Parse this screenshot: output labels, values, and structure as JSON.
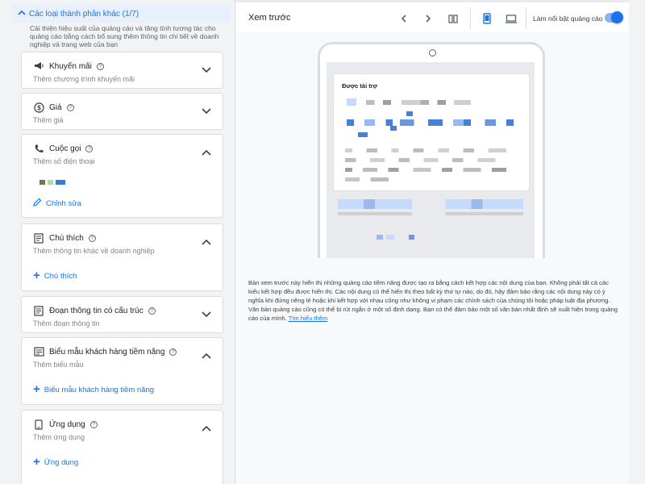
{
  "left_panel": {
    "section_title": "Các loại thành phần khác (1/7)",
    "section_description": "Cải thiện hiệu suất của quảng cáo và tăng tính tương tác cho quảng cáo bằng cách bổ sung thêm thông tin chi tiết về doanh nghiệp và trang web của bạn",
    "cards": [
      {
        "title": "Khuyến mãi",
        "subtitle": "Thêm chương trình khuyến mãi",
        "icon": "megaphone-icon",
        "expanded": false
      },
      {
        "title": "Giá",
        "subtitle": "Thêm giá",
        "icon": "dollar-icon",
        "expanded": false
      },
      {
        "title": "Cuộc gọi",
        "subtitle": "Thêm số điện thoại",
        "icon": "phone-icon",
        "expanded": true,
        "action": "Chỉnh sửa",
        "action_icon": "pencil-icon"
      },
      {
        "title": "Chú thích",
        "subtitle": "Thêm thông tin khác về doanh nghiệp",
        "icon": "document-icon",
        "expanded": true,
        "action": "Chú thích",
        "action_icon": "plus-icon"
      },
      {
        "title": "Đoạn thông tin có cấu trúc",
        "subtitle": "Thêm đoạn thông tin",
        "icon": "document-icon",
        "expanded": false
      },
      {
        "title": "Biểu mẫu khách hàng tiềm năng",
        "subtitle": "Thêm biểu mẫu",
        "icon": "form-icon",
        "expanded": true,
        "action": "Biểu mẫu khách hàng tiềm năng",
        "action_icon": "plus-icon"
      },
      {
        "title": "Ứng dụng",
        "subtitle": "Thêm ứng dụng",
        "icon": "mobile-icon",
        "expanded": true,
        "action": "Ứng dụng",
        "action_icon": "plus-icon"
      }
    ]
  },
  "preview": {
    "title": "Xem trước",
    "highlight_label": "Làm nổi bật quảng cáo",
    "highlight_enabled": true,
    "sponsored_label": "Được tài trợ",
    "disclaimer": "Bản xem trước này hiển thị những quảng cáo tiềm năng được tạo ra bằng cách kết hợp các nội dung của bạn. Không phải tất cả các kiểu kết hợp đều được hiển thị. Các nội dung có thể hiển thị theo bất kỳ thứ tự nào, do đó, hãy đảm bảo rằng các nội dung này có ý nghĩa khi đứng riêng lẻ hoặc khi kết hợp với nhau cũng như không vi phạm các chính sách của chúng tôi hoặc pháp luật địa phương. Văn bản quảng cáo cũng có thể bị rút ngắn ở một số định dạng. Bạn có thể đảm bảo một số văn bản nhất định sẽ xuất hiện trong quảng cáo của mình.",
    "learn_more": "Tìm hiểu thêm"
  },
  "colors": {
    "accent": "#1a73e8",
    "panel_bg": "#f1f3f4"
  }
}
